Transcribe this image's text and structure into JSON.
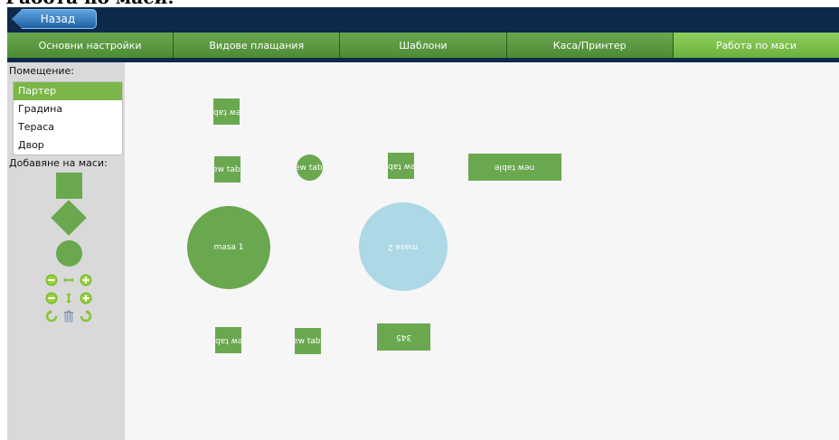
{
  "page": {
    "heading": "Работа по маси:"
  },
  "topbar": {
    "back_label": "Назад"
  },
  "tabs": [
    {
      "label": "Основни настройки"
    },
    {
      "label": "Видове плащания"
    },
    {
      "label": "Шаблони"
    },
    {
      "label": "Каса/Принтер"
    },
    {
      "label": "Работа по маси",
      "active": true
    }
  ],
  "sidebar": {
    "room_label": "Помещение:",
    "rooms": [
      {
        "label": "Партер",
        "selected": true
      },
      {
        "label": "Градина"
      },
      {
        "label": "Тераса"
      },
      {
        "label": "Двор"
      }
    ],
    "add_label": "Добавяне на маси:"
  },
  "tables": [
    {
      "label": "new table"
    },
    {
      "label": "new table"
    },
    {
      "label": "new table"
    },
    {
      "label": "new table"
    },
    {
      "label": "new table"
    },
    {
      "label": "masa 1"
    },
    {
      "label": "masa 2"
    },
    {
      "label": "new table"
    },
    {
      "label": "new table"
    },
    {
      "label": "345"
    }
  ],
  "colors": {
    "accent_green": "#6aa84f",
    "selected_green": "#7ab648",
    "topbar_navy": "#0d2a4a",
    "selected_table_blue": "#add8e6",
    "canvas_bg": "#f6f6f6",
    "sidebar_bg": "#d9d9d9"
  },
  "controls": {
    "icons": [
      "minus-width-icon",
      "width-arrows-icon",
      "plus-width-icon",
      "minus-height-icon",
      "height-arrows-icon",
      "plus-height-icon",
      "rotate-left-icon",
      "trash-icon",
      "rotate-right-icon"
    ]
  }
}
